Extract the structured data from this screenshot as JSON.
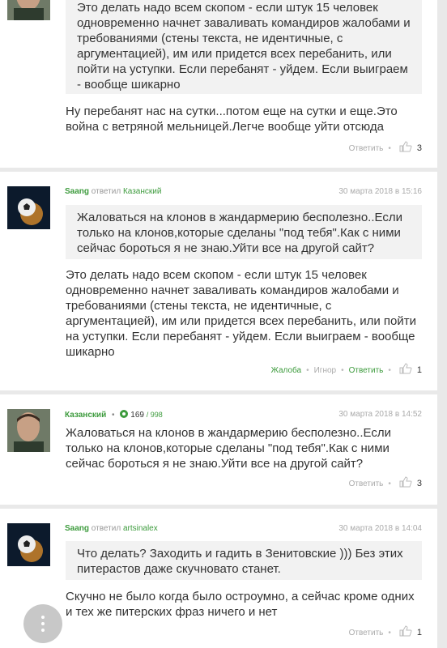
{
  "labels": {
    "reply_word": "ответил",
    "reply_action": "Ответить",
    "complain_action": "Жалоба",
    "ignore_action": "Игнор"
  },
  "icons": {
    "like": "thumbs-up-icon",
    "more": "more-vertical-icon"
  },
  "colors": {
    "accent": "#3d9b3d",
    "quote_bg": "#f2f2f2",
    "page_bg": "#e9e9e9"
  },
  "posts": [
    {
      "quote": "Это делать надо всем скопом - если штук 15 человек одновременно начнет заваливать командиров жалобами и требованиями (стены текста, не идентичные, с аргументацией), им или придется всех перебанить, или пойти на уступки. Если перебанят - уйдем. Если выиграем - вообще шикарно",
      "text": "Ну перебанят нас на сутки...потом еще на сутки и еще.Это война с ветряной мельницей.Легче вообще уйти отсюда",
      "likes": "3"
    },
    {
      "author": "Saang",
      "reply_to": "Казанский",
      "date": "30 марта 2018 в 15:16",
      "quote": "Жаловаться на клонов в жандармерию бесполезно..Если только на клонов,которые сделаны \"под тебя\".Как с ними сейчас бороться я не знаю.Уйти все на другой сайт?",
      "text": "Это делать надо всем скопом - если штук 15 человек одновременно начнет заваливать командиров жалобами и требованиями (стены текста, не идентичные, с аргументацией), им или придется всех перебанить, или пойти на уступки. Если перебанят - уйдем. Если выиграем - вообще шикарно",
      "likes": "1"
    },
    {
      "author": "Казанский",
      "rating": "169",
      "rating_max": "/ 998",
      "date": "30 марта 2018 в 14:52",
      "text": "Жаловаться на клонов в жандармерию бесполезно..Если только на клонов,которые сделаны \"под тебя\".Как с ними сейчас бороться я не знаю.Уйти все на другой сайт?",
      "likes": "3"
    },
    {
      "author": "Saang",
      "reply_to": "artsinalex",
      "date": "30 марта 2018 в 14:04",
      "quote": "Что делать? Заходить и гадить в Зенитовские ))) Без этих питерастов даже скучновато станет.",
      "text": "Скучно не было когда было остроумно, а сейчас кроме одних и тех же питерских фраз ничего и нет",
      "likes": "1"
    }
  ]
}
